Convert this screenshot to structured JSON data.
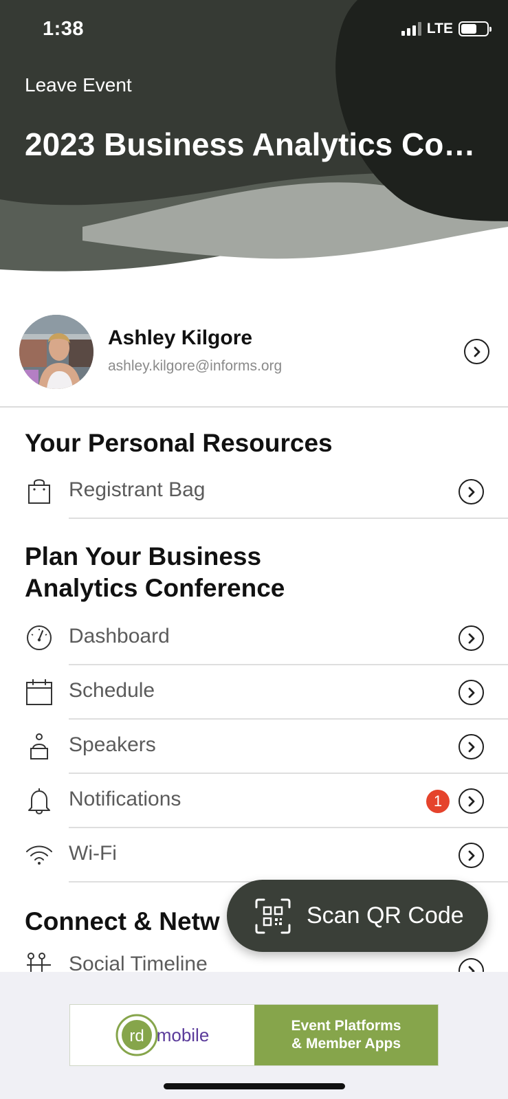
{
  "status_bar": {
    "time": "1:38",
    "network": "LTE"
  },
  "header": {
    "leave_label": "Leave Event",
    "event_title": "2023 Business Analytics Co…",
    "colors": {
      "dark": "#363a34",
      "darker": "#1e211d",
      "mid": "#585e56",
      "light": "#a3a7a1"
    }
  },
  "profile": {
    "name": "Ashley Kilgore",
    "email": "ashley.kilgore@informs.org"
  },
  "sections": {
    "personal": {
      "title": "Your Personal Resources",
      "items": [
        {
          "label": "Registrant Bag",
          "icon": "bag-icon"
        }
      ]
    },
    "plan": {
      "title_line1": "Plan Your Business",
      "title_line2": "Analytics Conference",
      "items": [
        {
          "label": "Dashboard",
          "icon": "dashboard-gauge-icon"
        },
        {
          "label": "Schedule",
          "icon": "calendar-icon"
        },
        {
          "label": "Speakers",
          "icon": "speaker-podium-icon"
        },
        {
          "label": "Notifications",
          "icon": "bell-icon",
          "badge": "1"
        },
        {
          "label": "Wi-Fi",
          "icon": "wifi-icon"
        }
      ]
    },
    "connect": {
      "title": "Connect & Netw",
      "items": [
        {
          "label": "Social Timeline",
          "icon": "people-icon"
        }
      ]
    }
  },
  "qr_button": {
    "label": "Scan QR Code"
  },
  "ad": {
    "logo_text": "rd",
    "brand": "mobile",
    "line1": "Event Platforms",
    "line2": "& Member Apps",
    "colors": {
      "green": "#86a54b",
      "purple": "#5a3a9a"
    }
  }
}
